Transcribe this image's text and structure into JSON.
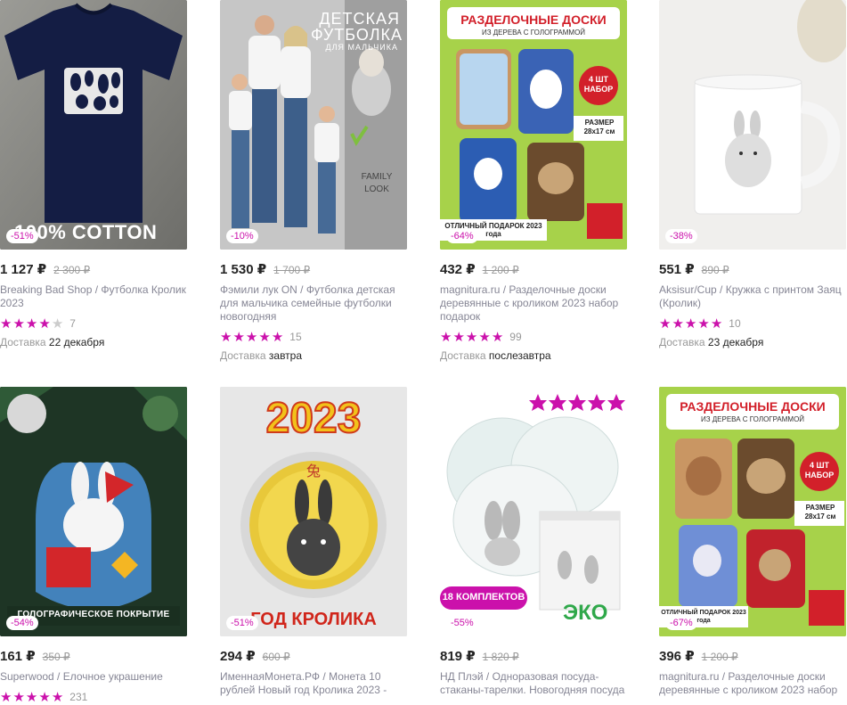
{
  "products": [
    {
      "price": "1 127 ₽",
      "old": "2 300 ₽",
      "brand": "Breaking Bad Shop",
      "name": "Футболка Кролик 2023",
      "stars": 4,
      "reviews": "7",
      "delivery_label": "Доставка",
      "delivery_value": "22 декабря",
      "discount": "-51%",
      "image_text": "100% COTTON"
    },
    {
      "price": "1 530 ₽",
      "old": "1 700 ₽",
      "brand": "Фэмили лук ON",
      "name": "Футболка детская для мальчика семейные футболки новогодняя",
      "stars": 5,
      "reviews": "15",
      "delivery_label": "Доставка",
      "delivery_value": "завтра",
      "discount": "-10%",
      "image_text": "ДЕТСКАЯ ФУТБОЛКА",
      "image_sub": "ДЛЯ МАЛЬЧИКА",
      "image_badge": "FAMILY LOOK"
    },
    {
      "price": "432 ₽",
      "old": "1 200 ₽",
      "brand": "magnitura.ru",
      "name": "Разделочные доски деревянные с кроликом 2023 набор подарок",
      "stars": 5,
      "reviews": "99",
      "delivery_label": "Доставка",
      "delivery_value": "послезавтра",
      "discount": "-64%",
      "image_text": "РАЗДЕЛОЧНЫЕ ДОСКИ",
      "image_sub": "ИЗ ДЕРЕВА С ГОЛОГРАММОЙ",
      "image_badge": "4 ШТ НАБОР",
      "image_size": "РАЗМЕР 28x17 см",
      "image_gift": "ОТЛИЧНЫЙ ПОДАРОК 2023 года"
    },
    {
      "price": "551 ₽",
      "old": "890 ₽",
      "brand": "Aksisur/Cup",
      "name": "Кружка с принтом Заяц (Кролик)",
      "stars": 5,
      "reviews": "10",
      "delivery_label": "Доставка",
      "delivery_value": "23 декабря",
      "discount": "-38%"
    },
    {
      "price": "161 ₽",
      "old": "350 ₽",
      "brand": "Superwood",
      "name": "Елочное украшение",
      "stars": 5,
      "reviews": "231",
      "discount": "-54%",
      "image_text": "ГОЛОГРАФИЧЕСКОЕ ПОКРЫТИЕ"
    },
    {
      "price": "294 ₽",
      "old": "600 ₽",
      "brand": "ИменнаяМонета.РФ",
      "name": "Монета 10 рублей Новый год Кролика 2023 -",
      "discount": "-51%",
      "image_text": "2023",
      "image_sub": "ГОД КРОЛИКА"
    },
    {
      "price": "819 ₽",
      "old": "1 820 ₽",
      "brand": "НД Плэй",
      "name": "Одноразовая посуда-стаканы-тарелки. Новогодняя посуда",
      "discount": "-55%",
      "image_text": "18 КОМПЛЕКТОВ",
      "image_badge": "ЭКО"
    },
    {
      "price": "396 ₽",
      "old": "1 200 ₽",
      "brand": "magnitura.ru",
      "name": "Разделочные доски деревянные с кроликом 2023 набор",
      "discount": "-67%",
      "image_text": "РАЗДЕЛОЧНЫЕ ДОСКИ",
      "image_sub": "ИЗ ДЕРЕВА С ГОЛОГРАММОЙ",
      "image_badge": "4 ШТ НАБОР",
      "image_size": "РАЗМЕР 28x17 см",
      "image_gift": "ОТЛИЧНЫЙ ПОДАРОК 2023 года"
    }
  ],
  "colors": {
    "accent": "#cb11ab",
    "muted": "#868695",
    "price": "#242424"
  }
}
